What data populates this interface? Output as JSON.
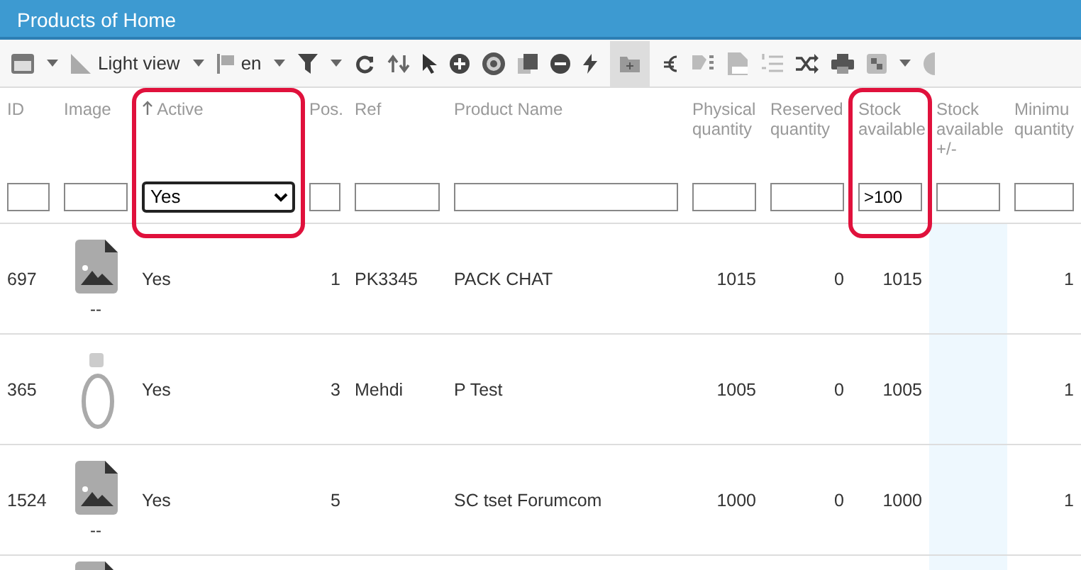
{
  "window": {
    "title": "Products of Home"
  },
  "toolbar": {
    "view_label": "Light view",
    "language": "en"
  },
  "table": {
    "columns": [
      {
        "label": "ID",
        "kind": "text",
        "sorted": false,
        "highlighted": false,
        "filter": {
          "kind": "input"
        }
      },
      {
        "label": "Image",
        "kind": "image",
        "sorted": false,
        "highlighted": false,
        "filter": {
          "kind": "input"
        }
      },
      {
        "label": "Active",
        "kind": "text",
        "sorted": true,
        "highlighted": true,
        "filter": {
          "kind": "select",
          "value": "Yes"
        }
      },
      {
        "label": "Pos.",
        "kind": "number",
        "sorted": false,
        "highlighted": false,
        "filter": {
          "kind": "input"
        }
      },
      {
        "label": "Ref",
        "kind": "text",
        "sorted": false,
        "highlighted": false,
        "filter": {
          "kind": "input"
        }
      },
      {
        "label": "Product Name",
        "kind": "text",
        "sorted": false,
        "highlighted": false,
        "filter": {
          "kind": "input"
        }
      },
      {
        "label": "Physical quantity",
        "kind": "number",
        "sorted": false,
        "highlighted": false,
        "filter": {
          "kind": "input"
        }
      },
      {
        "label": "Reserved quantity",
        "kind": "number",
        "sorted": false,
        "highlighted": false,
        "filter": {
          "kind": "input"
        }
      },
      {
        "label": "Stock available",
        "kind": "number",
        "sorted": false,
        "highlighted": true,
        "filter": {
          "kind": "input",
          "value": ">100"
        }
      },
      {
        "label": "Stock available +/-",
        "kind": "shaded",
        "sorted": false,
        "highlighted": false,
        "filter": {
          "kind": "input"
        }
      },
      {
        "label": "Minimu quantity",
        "kind": "number",
        "sorted": false,
        "highlighted": false,
        "filter": {
          "kind": "input"
        }
      }
    ],
    "rows": [
      {
        "cells": [
          "697",
          {
            "kind": "placeholder",
            "caption": "--"
          },
          "Yes",
          "1",
          "PK3345",
          "PACK CHAT",
          "1015",
          "0",
          "1015",
          null,
          "1"
        ]
      },
      {
        "cells": [
          "365",
          {
            "kind": "photo"
          },
          "Yes",
          "3",
          "Mehdi",
          "P Test",
          "1005",
          "0",
          "1005",
          null,
          "1"
        ]
      },
      {
        "cells": [
          "1524",
          {
            "kind": "placeholder",
            "caption": "--"
          },
          "Yes",
          "5",
          null,
          "SC tset Forumcom",
          "1000",
          "0",
          "1000",
          null,
          "1"
        ]
      },
      {
        "cells": [
          null,
          {
            "kind": "placeholder"
          },
          null,
          null,
          null,
          null,
          null,
          null,
          null,
          null,
          null
        ]
      }
    ]
  }
}
